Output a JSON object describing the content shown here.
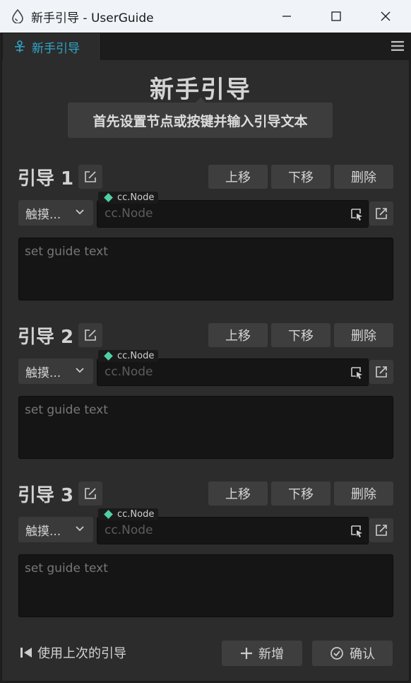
{
  "window": {
    "title": "新手引导 - UserGuide",
    "icon": "app-drop-icon",
    "controls": [
      "minimize-icon",
      "maximize-icon",
      "close-icon"
    ]
  },
  "tab": {
    "label": "新手引导",
    "icon": "guide-icon"
  },
  "panel": {
    "heading": "新手引导",
    "tooltip": "首先设置节点或按键并输入引导文本"
  },
  "guides": [
    {
      "label": "引导 1",
      "event_select": "触摸...",
      "node_tag": "cc.Node",
      "node_placeholder": "cc.Node",
      "text_placeholder": "set guide text",
      "move_up": "上移",
      "move_down": "下移",
      "delete": "删除"
    },
    {
      "label": "引导 2",
      "event_select": "触摸...",
      "node_tag": "cc.Node",
      "node_placeholder": "cc.Node",
      "text_placeholder": "set guide text",
      "move_up": "上移",
      "move_down": "下移",
      "delete": "删除"
    },
    {
      "label": "引导 3",
      "event_select": "触摸...",
      "node_tag": "cc.Node",
      "node_placeholder": "cc.Node",
      "text_placeholder": "set guide text",
      "move_up": "上移",
      "move_down": "下移",
      "delete": "删除"
    }
  ],
  "footer": {
    "use_last": "使用上次的引导",
    "add": "新增",
    "confirm": "确认"
  },
  "colors": {
    "accent": "#2fa7c8",
    "node_dot": "#4fd0a4",
    "panel_bg": "#2c2c2c"
  }
}
